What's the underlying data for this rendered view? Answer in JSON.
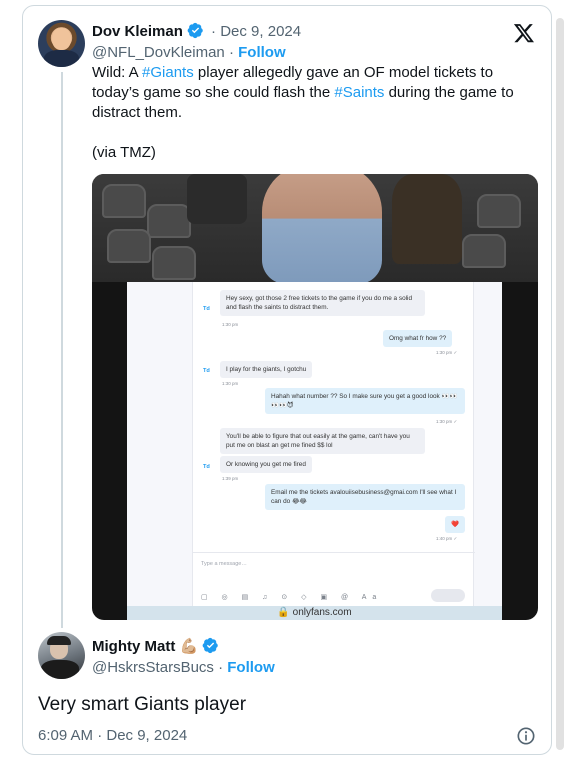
{
  "quoted_tweet": {
    "author_name": "Dov Kleiman",
    "date": "Dec 9, 2024",
    "handle": "@NFL_DovKleiman",
    "follow_label": "Follow",
    "text_before_1": "Wild: A ",
    "hashtag_1": "#Giants",
    "text_mid": " player allegedly gave an OF model tickets to today’s game so she could flash the ",
    "hashtag_2": "#Saints",
    "text_after": " during the game to distract them.",
    "via": "(via TMZ)"
  },
  "media": {
    "messages": [
      {
        "dir": "in",
        "sender": "Td",
        "text": "Hey sexy, got those 2 free tickets to the game if you do me a solid and flash the saints to distract them.",
        "time": "1:30 pm"
      },
      {
        "dir": "out",
        "text": "Omg what fr how ??",
        "time": "1:30 pm ✓"
      },
      {
        "dir": "in",
        "sender": "Td",
        "text": "I play for the giants, I gotchu",
        "time": "1:30 pm"
      },
      {
        "dir": "out",
        "text": "Hahah what number ?? So I make sure you get a good look 👀👀👀👀😈",
        "time": "1:30 pm ✓"
      },
      {
        "dir": "in",
        "text": "You'll be able to figure that out easily at the game, can't have you put me on blast an get me fined $$ lol",
        "time": ""
      },
      {
        "dir": "in",
        "sender": "Td",
        "text": "Or knowing you get me fired",
        "time": "1:39 pm"
      },
      {
        "dir": "out",
        "text": "Email me the tickets avalouiisebusiness@gmai.com I'll see what I can do 😂😂",
        "time": ""
      },
      {
        "dir": "out",
        "text": "❤️",
        "time": "1:40 pm ✓"
      }
    ],
    "input_placeholder": "Type a message…",
    "input_icons": "▢ ◎ ▤ ♫ ⊙ ◇ ▣ @ Aa",
    "url": "🔒 onlyfans.com"
  },
  "reply": {
    "author_name": "Mighty Matt",
    "emoji": "💪🏼",
    "handle": "@HskrsStarsBucs",
    "follow_label": "Follow",
    "text": "Very smart Giants player",
    "timestamp": "6:09 AM · Dec 9, 2024"
  },
  "colors": {
    "accent": "#1d9bf0",
    "muted": "#536471",
    "text": "#0f1419",
    "border": "#cfd9de"
  },
  "icons": {
    "verified": "verified-badge-icon",
    "x_logo": "x-logo-icon",
    "info": "info-icon"
  }
}
